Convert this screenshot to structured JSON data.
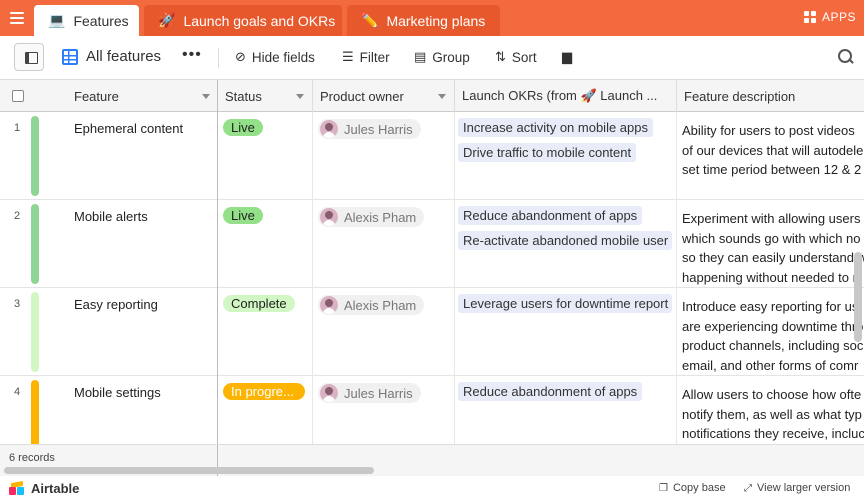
{
  "tabs": [
    {
      "label": "Features",
      "icon": "laptop-icon",
      "glyph": "💻"
    },
    {
      "label": "Launch goals and OKRs",
      "icon": "rocket-icon",
      "glyph": "🚀"
    },
    {
      "label": "Marketing plans",
      "icon": "pencil-icon",
      "glyph": "✏️"
    }
  ],
  "apps_label": "APPS",
  "toolbar": {
    "view_name": "All features",
    "more": "•••",
    "hide_fields": "Hide fields",
    "filter": "Filter",
    "group": "Group",
    "sort": "Sort"
  },
  "columns": {
    "feature": "Feature",
    "status": "Status",
    "owner": "Product owner",
    "okrs": "Launch OKRs (from 🚀 Launch ...",
    "description": "Feature description"
  },
  "rows": [
    {
      "num": "1",
      "feature": "Ephemeral content",
      "bar_color": "#8fd694",
      "status": "Live",
      "status_color": "#93e088",
      "owner": "Jules Harris",
      "okrs": [
        "Increase activity on mobile apps",
        "Drive traffic to mobile content"
      ],
      "description": [
        "Ability for users to post videos",
        "of our devices that will autodele",
        "set time period between 12 & 2"
      ]
    },
    {
      "num": "2",
      "feature": "Mobile alerts",
      "bar_color": "#8fd694",
      "status": "Live",
      "status_color": "#93e088",
      "owner": "Alexis Pham",
      "okrs": [
        "Reduce abandonment of apps",
        "Re-activate abandoned mobile user"
      ],
      "description": [
        "Experiment with allowing users",
        "which sounds go with which no",
        "so they can easily understand w",
        "happening without needed to r"
      ]
    },
    {
      "num": "3",
      "feature": "Easy reporting",
      "bar_color": "#d2f7c5",
      "status": "Complete",
      "status_color": "#d1f7c4",
      "owner": "Alexis Pham",
      "okrs": [
        "Leverage users for downtime report"
      ],
      "description": [
        "Introduce easy reporting for us",
        "are experiencing downtime thro",
        "product channels, including soc",
        "email, and other forms of comr"
      ]
    },
    {
      "num": "4",
      "feature": "Mobile settings",
      "bar_color": "#fcb400",
      "status": "In progre...",
      "status_color": "#fcb400",
      "owner": "Jules Harris",
      "okrs": [
        "Reduce abandonment of apps"
      ],
      "description": [
        "Allow users to choose how ofte",
        "notify them, as well as what typ",
        "notifications they receive, incluc"
      ]
    }
  ],
  "footer": {
    "record_count": "6 records"
  },
  "brandbar": {
    "brand": "Airtable",
    "copy_base": "Copy base",
    "view_larger": "View larger version"
  },
  "colors": {
    "accent": "#f26a3d",
    "brand_blue": "#2d7ff9"
  }
}
